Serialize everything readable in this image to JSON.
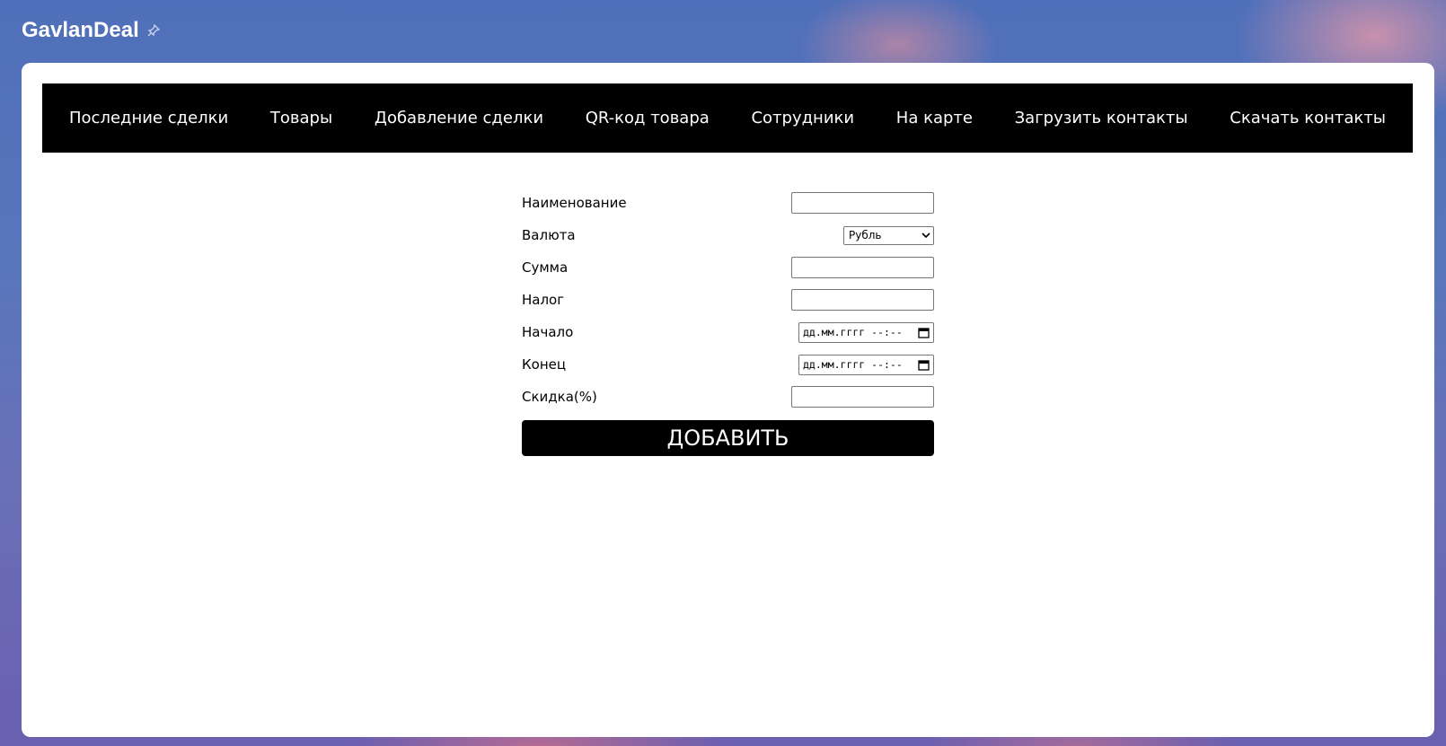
{
  "app": {
    "title": "GavlanDeal",
    "pin_icon": "pin-icon"
  },
  "nav": {
    "items": [
      {
        "label": "Последние сделки"
      },
      {
        "label": "Товары"
      },
      {
        "label": "Добавление сделки"
      },
      {
        "label": "QR-код товара"
      },
      {
        "label": "Сотрудники"
      },
      {
        "label": "На карте"
      },
      {
        "label": "Загрузить контакты"
      },
      {
        "label": "Скачать контакты"
      }
    ]
  },
  "form": {
    "name_label": "Наименование",
    "name_value": "",
    "currency_label": "Валюта",
    "currency_selected": "Рубль",
    "sum_label": "Сумма",
    "sum_value": "",
    "tax_label": "Налог",
    "tax_value": "",
    "start_label": "Начало",
    "start_placeholder": "дд.мм.гггг --:--",
    "end_label": "Конец",
    "end_placeholder": "дд.мм.гггг --:--",
    "discount_label": "Скидка(%)",
    "discount_value": "",
    "submit_label": "ДОБАВИТЬ"
  },
  "colors": {
    "navbar_bg": "#000000",
    "button_bg": "#000000",
    "card_bg": "#ffffff"
  }
}
